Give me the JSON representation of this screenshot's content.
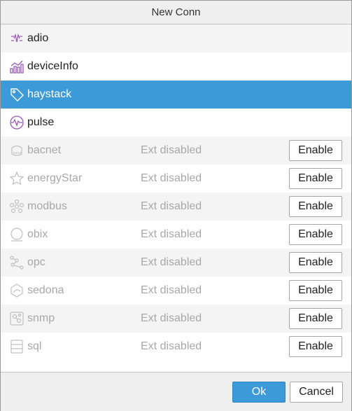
{
  "dialog": {
    "title": "New Conn",
    "ok_label": "Ok",
    "cancel_label": "Cancel"
  },
  "connectors": [
    {
      "name": "adio",
      "icon": "adio-icon",
      "enabled": true,
      "selected": false
    },
    {
      "name": "deviceInfo",
      "icon": "bar-chart-icon",
      "enabled": true,
      "selected": false
    },
    {
      "name": "haystack",
      "icon": "tag-icon",
      "enabled": true,
      "selected": true
    },
    {
      "name": "pulse",
      "icon": "pulse-icon",
      "enabled": true,
      "selected": false
    },
    {
      "name": "bacnet",
      "icon": "bacnet-icon",
      "enabled": false,
      "status": "Ext disabled",
      "button": "Enable"
    },
    {
      "name": "energyStar",
      "icon": "star-icon",
      "enabled": false,
      "status": "Ext disabled",
      "button": "Enable"
    },
    {
      "name": "modbus",
      "icon": "modbus-icon",
      "enabled": false,
      "status": "Ext disabled",
      "button": "Enable"
    },
    {
      "name": "obix",
      "icon": "obix-icon",
      "enabled": false,
      "status": "Ext disabled",
      "button": "Enable"
    },
    {
      "name": "opc",
      "icon": "opc-icon",
      "enabled": false,
      "status": "Ext disabled",
      "button": "Enable"
    },
    {
      "name": "sedona",
      "icon": "sedona-icon",
      "enabled": false,
      "status": "Ext disabled",
      "button": "Enable"
    },
    {
      "name": "snmp",
      "icon": "snmp-icon",
      "enabled": false,
      "status": "Ext disabled",
      "button": "Enable"
    },
    {
      "name": "sql",
      "icon": "database-icon",
      "enabled": false,
      "status": "Ext disabled",
      "button": "Enable"
    }
  ],
  "colors": {
    "selection": "#3d9ad8",
    "enabled_icon": "#9b59b6",
    "disabled_text": "#a8a8a8"
  }
}
